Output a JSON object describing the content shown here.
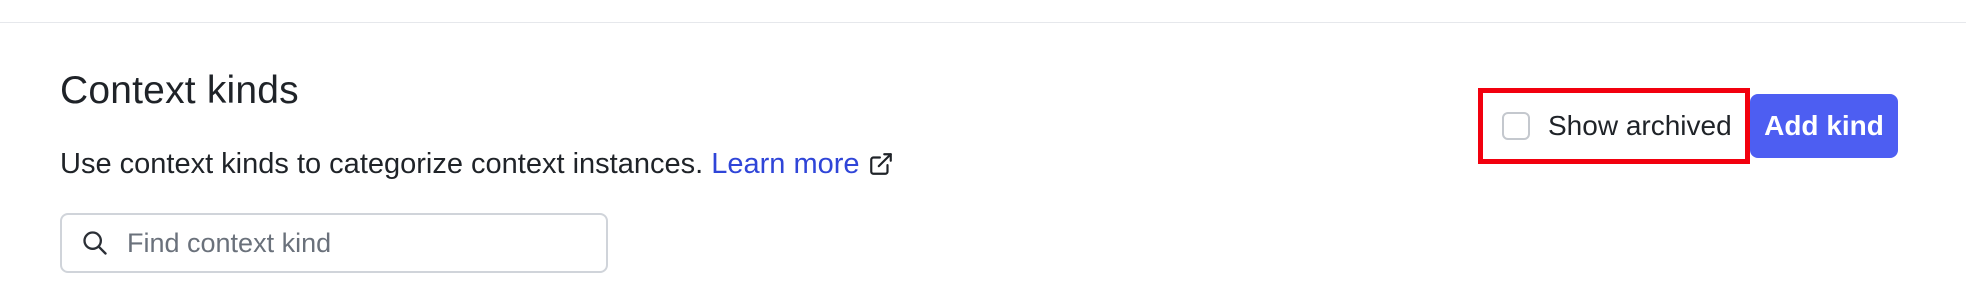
{
  "header": {
    "title": "Context kinds",
    "description": "Use context kinds to categorize context instances.",
    "learn_more_label": "Learn more",
    "learn_more_icon": "external-link-icon"
  },
  "search": {
    "placeholder": "Find context kind",
    "value": "",
    "icon": "search-icon"
  },
  "filters": {
    "show_archived_label": "Show archived",
    "show_archived_checked": false,
    "highlight_color": "#f2000e"
  },
  "actions": {
    "add_label": "Add kind",
    "add_color": "#4d5ef2"
  },
  "colors": {
    "link": "#2f45d8",
    "text": "#1f2328"
  }
}
